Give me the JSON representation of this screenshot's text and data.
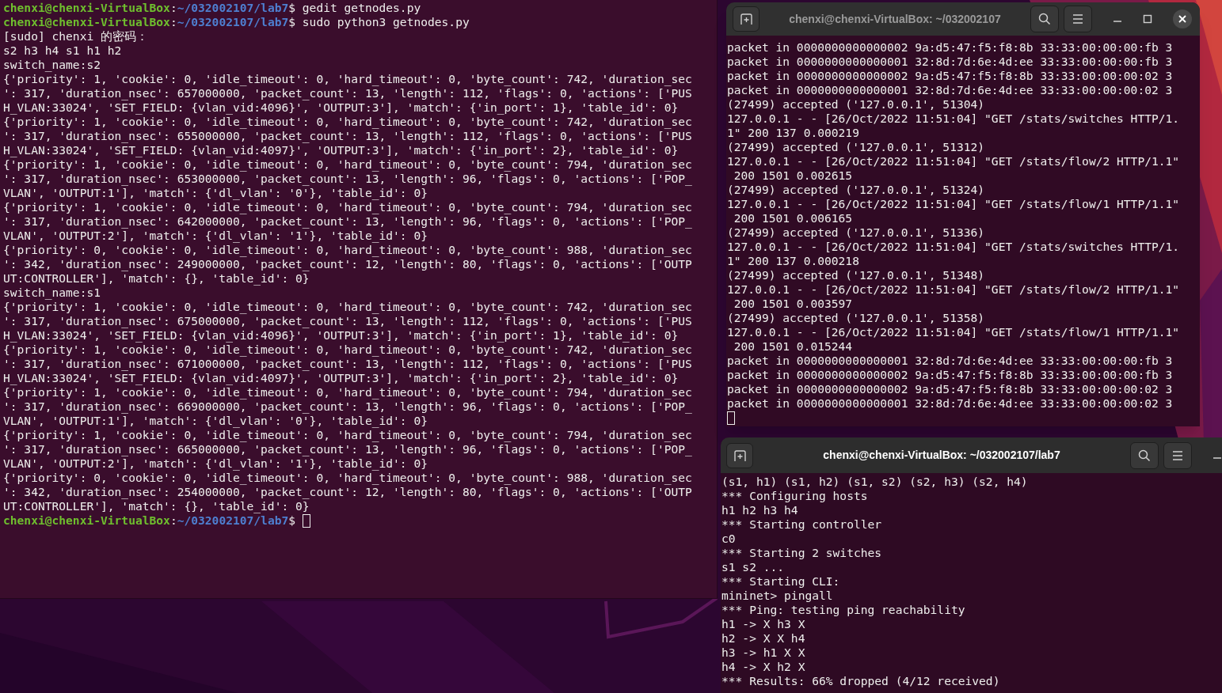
{
  "left_terminal": {
    "lines": [
      {
        "kind": "prompt",
        "user": "chenxi@chenxi-VirtualBox",
        "sep": ":",
        "path": "~/032002107/lab7",
        "command": "$ gedit getnodes.py",
        "cursor": false
      },
      {
        "kind": "prompt",
        "user": "chenxi@chenxi-VirtualBox",
        "sep": ":",
        "path": "~/032002107/lab7",
        "command": "$ sudo python3 getnodes.py",
        "cursor": false
      },
      {
        "kind": "text",
        "text": "[sudo] chenxi 的密码："
      },
      {
        "kind": "text",
        "text": "s2 h3 h4 s1 h1 h2"
      },
      {
        "kind": "text",
        "text": "switch_name:s2"
      },
      {
        "kind": "text",
        "text": "{'priority': 1, 'cookie': 0, 'idle_timeout': 0, 'hard_timeout': 0, 'byte_count': 742, 'duration_sec"
      },
      {
        "kind": "text",
        "text": "': 317, 'duration_nsec': 657000000, 'packet_count': 13, 'length': 112, 'flags': 0, 'actions': ['PUS"
      },
      {
        "kind": "text",
        "text": "H_VLAN:33024', 'SET_FIELD: {vlan_vid:4096}', 'OUTPUT:3'], 'match': {'in_port': 1}, 'table_id': 0}"
      },
      {
        "kind": "text",
        "text": "{'priority': 1, 'cookie': 0, 'idle_timeout': 0, 'hard_timeout': 0, 'byte_count': 742, 'duration_sec"
      },
      {
        "kind": "text",
        "text": "': 317, 'duration_nsec': 655000000, 'packet_count': 13, 'length': 112, 'flags': 0, 'actions': ['PUS"
      },
      {
        "kind": "text",
        "text": "H_VLAN:33024', 'SET_FIELD: {vlan_vid:4097}', 'OUTPUT:3'], 'match': {'in_port': 2}, 'table_id': 0}"
      },
      {
        "kind": "text",
        "text": "{'priority': 1, 'cookie': 0, 'idle_timeout': 0, 'hard_timeout': 0, 'byte_count': 794, 'duration_sec"
      },
      {
        "kind": "text",
        "text": "': 317, 'duration_nsec': 653000000, 'packet_count': 13, 'length': 96, 'flags': 0, 'actions': ['POP_"
      },
      {
        "kind": "text",
        "text": "VLAN', 'OUTPUT:1'], 'match': {'dl_vlan': '0'}, 'table_id': 0}"
      },
      {
        "kind": "text",
        "text": "{'priority': 1, 'cookie': 0, 'idle_timeout': 0, 'hard_timeout': 0, 'byte_count': 794, 'duration_sec"
      },
      {
        "kind": "text",
        "text": "': 317, 'duration_nsec': 642000000, 'packet_count': 13, 'length': 96, 'flags': 0, 'actions': ['POP_"
      },
      {
        "kind": "text",
        "text": "VLAN', 'OUTPUT:2'], 'match': {'dl_vlan': '1'}, 'table_id': 0}"
      },
      {
        "kind": "text",
        "text": "{'priority': 0, 'cookie': 0, 'idle_timeout': 0, 'hard_timeout': 0, 'byte_count': 988, 'duration_sec"
      },
      {
        "kind": "text",
        "text": "': 342, 'duration_nsec': 249000000, 'packet_count': 12, 'length': 80, 'flags': 0, 'actions': ['OUTP"
      },
      {
        "kind": "text",
        "text": "UT:CONTROLLER'], 'match': {}, 'table_id': 0}"
      },
      {
        "kind": "text",
        "text": "switch_name:s1"
      },
      {
        "kind": "text",
        "text": "{'priority': 1, 'cookie': 0, 'idle_timeout': 0, 'hard_timeout': 0, 'byte_count': 742, 'duration_sec"
      },
      {
        "kind": "text",
        "text": "': 317, 'duration_nsec': 675000000, 'packet_count': 13, 'length': 112, 'flags': 0, 'actions': ['PUS"
      },
      {
        "kind": "text",
        "text": "H_VLAN:33024', 'SET_FIELD: {vlan_vid:4096}', 'OUTPUT:3'], 'match': {'in_port': 1}, 'table_id': 0}"
      },
      {
        "kind": "text",
        "text": "{'priority': 1, 'cookie': 0, 'idle_timeout': 0, 'hard_timeout': 0, 'byte_count': 742, 'duration_sec"
      },
      {
        "kind": "text",
        "text": "': 317, 'duration_nsec': 671000000, 'packet_count': 13, 'length': 112, 'flags': 0, 'actions': ['PUS"
      },
      {
        "kind": "text",
        "text": "H_VLAN:33024', 'SET_FIELD: {vlan_vid:4097}', 'OUTPUT:3'], 'match': {'in_port': 2}, 'table_id': 0}"
      },
      {
        "kind": "text",
        "text": "{'priority': 1, 'cookie': 0, 'idle_timeout': 0, 'hard_timeout': 0, 'byte_count': 794, 'duration_sec"
      },
      {
        "kind": "text",
        "text": "': 317, 'duration_nsec': 669000000, 'packet_count': 13, 'length': 96, 'flags': 0, 'actions': ['POP_"
      },
      {
        "kind": "text",
        "text": "VLAN', 'OUTPUT:1'], 'match': {'dl_vlan': '0'}, 'table_id': 0}"
      },
      {
        "kind": "text",
        "text": "{'priority': 1, 'cookie': 0, 'idle_timeout': 0, 'hard_timeout': 0, 'byte_count': 794, 'duration_sec"
      },
      {
        "kind": "text",
        "text": "': 317, 'duration_nsec': 665000000, 'packet_count': 13, 'length': 96, 'flags': 0, 'actions': ['POP_"
      },
      {
        "kind": "text",
        "text": "VLAN', 'OUTPUT:2'], 'match': {'dl_vlan': '1'}, 'table_id': 0}"
      },
      {
        "kind": "text",
        "text": "{'priority': 0, 'cookie': 0, 'idle_timeout': 0, 'hard_timeout': 0, 'byte_count': 988, 'duration_sec"
      },
      {
        "kind": "text",
        "text": "': 342, 'duration_nsec': 254000000, 'packet_count': 12, 'length': 80, 'flags': 0, 'actions': ['OUTP"
      },
      {
        "kind": "text",
        "text": "UT:CONTROLLER'], 'match': {}, 'table_id': 0}"
      },
      {
        "kind": "prompt",
        "user": "chenxi@chenxi-VirtualBox",
        "sep": ":",
        "path": "~/032002107/lab7",
        "command": "$ ",
        "cursor": true
      }
    ]
  },
  "top_terminal": {
    "title": "chenxi@chenxi-VirtualBox: ~/032002107",
    "active": false,
    "cursor": true,
    "lines": [
      {
        "kind": "text",
        "text": "packet in 0000000000000002 9a:d5:47:f5:f8:8b 33:33:00:00:00:fb 3"
      },
      {
        "kind": "text",
        "text": "packet in 0000000000000001 32:8d:7d:6e:4d:ee 33:33:00:00:00:fb 3"
      },
      {
        "kind": "text",
        "text": "packet in 0000000000000002 9a:d5:47:f5:f8:8b 33:33:00:00:00:02 3"
      },
      {
        "kind": "text",
        "text": "packet in 0000000000000001 32:8d:7d:6e:4d:ee 33:33:00:00:00:02 3"
      },
      {
        "kind": "text",
        "text": "(27499) accepted ('127.0.0.1', 51304)"
      },
      {
        "kind": "text",
        "text": "127.0.0.1 - - [26/Oct/2022 11:51:04] \"GET /stats/switches HTTP/1."
      },
      {
        "kind": "text",
        "text": "1\" 200 137 0.000219"
      },
      {
        "kind": "text",
        "text": "(27499) accepted ('127.0.0.1', 51312)"
      },
      {
        "kind": "text",
        "text": "127.0.0.1 - - [26/Oct/2022 11:51:04] \"GET /stats/flow/2 HTTP/1.1\""
      },
      {
        "kind": "text",
        "text": " 200 1501 0.002615"
      },
      {
        "kind": "text",
        "text": "(27499) accepted ('127.0.0.1', 51324)"
      },
      {
        "kind": "text",
        "text": "127.0.0.1 - - [26/Oct/2022 11:51:04] \"GET /stats/flow/1 HTTP/1.1\""
      },
      {
        "kind": "text",
        "text": " 200 1501 0.006165"
      },
      {
        "kind": "text",
        "text": "(27499) accepted ('127.0.0.1', 51336)"
      },
      {
        "kind": "text",
        "text": "127.0.0.1 - - [26/Oct/2022 11:51:04] \"GET /stats/switches HTTP/1."
      },
      {
        "kind": "text",
        "text": "1\" 200 137 0.000218"
      },
      {
        "kind": "text",
        "text": "(27499) accepted ('127.0.0.1', 51348)"
      },
      {
        "kind": "text",
        "text": "127.0.0.1 - - [26/Oct/2022 11:51:04] \"GET /stats/flow/2 HTTP/1.1\""
      },
      {
        "kind": "text",
        "text": " 200 1501 0.003597"
      },
      {
        "kind": "text",
        "text": "(27499) accepted ('127.0.0.1', 51358)"
      },
      {
        "kind": "text",
        "text": "127.0.0.1 - - [26/Oct/2022 11:51:04] \"GET /stats/flow/1 HTTP/1.1\""
      },
      {
        "kind": "text",
        "text": " 200 1501 0.015244"
      },
      {
        "kind": "text",
        "text": "packet in 0000000000000001 32:8d:7d:6e:4d:ee 33:33:00:00:00:fb 3"
      },
      {
        "kind": "text",
        "text": "packet in 0000000000000002 9a:d5:47:f5:f8:8b 33:33:00:00:00:fb 3"
      },
      {
        "kind": "text",
        "text": "packet in 0000000000000002 9a:d5:47:f5:f8:8b 33:33:00:00:00:02 3"
      },
      {
        "kind": "text",
        "text": "packet in 0000000000000001 32:8d:7d:6e:4d:ee 33:33:00:00:00:02 3"
      }
    ]
  },
  "bottom_terminal": {
    "title": "chenxi@chenxi-VirtualBox: ~/032002107/lab7",
    "active": true,
    "lines": [
      {
        "kind": "text",
        "text": "(s1, h1) (s1, h2) (s1, s2) (s2, h3) (s2, h4)"
      },
      {
        "kind": "text",
        "text": "*** Configuring hosts"
      },
      {
        "kind": "text",
        "text": "h1 h2 h3 h4"
      },
      {
        "kind": "text",
        "text": "*** Starting controller"
      },
      {
        "kind": "text",
        "text": "c0"
      },
      {
        "kind": "text",
        "text": "*** Starting 2 switches"
      },
      {
        "kind": "text",
        "text": "s1 s2 ..."
      },
      {
        "kind": "text",
        "text": "*** Starting CLI:"
      },
      {
        "kind": "text",
        "text": "mininet> pingall"
      },
      {
        "kind": "text",
        "text": "*** Ping: testing ping reachability"
      },
      {
        "kind": "text",
        "text": "h1 -> X h3 X"
      },
      {
        "kind": "text",
        "text": "h2 -> X X h4"
      },
      {
        "kind": "text",
        "text": "h3 -> h1 X X"
      },
      {
        "kind": "text",
        "text": "h4 -> X h2 X"
      },
      {
        "kind": "text",
        "text": "*** Results: 66% dropped (4/12 received)"
      }
    ]
  }
}
